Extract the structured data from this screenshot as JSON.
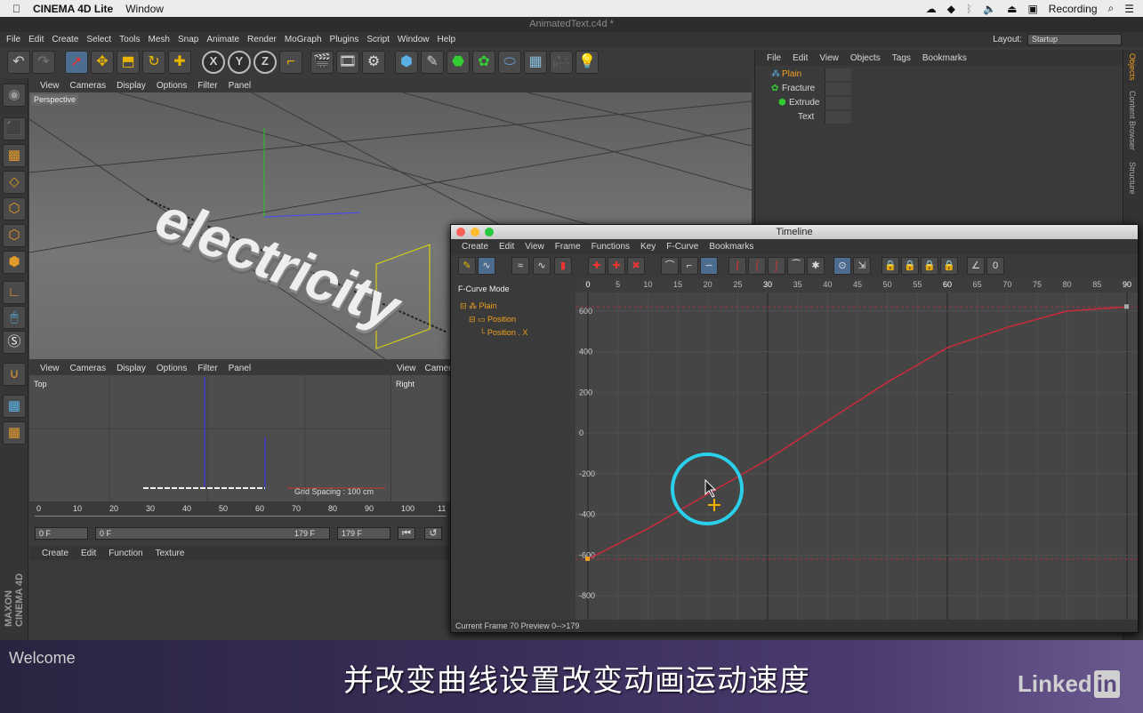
{
  "mac_menubar": {
    "app": "CINEMA 4D Lite",
    "menu": "Window",
    "recording": "Recording"
  },
  "document_title": "AnimatedText.c4d *",
  "main_menu": [
    "File",
    "Edit",
    "Create",
    "Select",
    "Tools",
    "Mesh",
    "Snap",
    "Animate",
    "Render",
    "MoGraph",
    "Plugins",
    "Script",
    "Window",
    "Help"
  ],
  "layout": {
    "label": "Layout:",
    "value": "Startup"
  },
  "viewport_menu": [
    "View",
    "Cameras",
    "Display",
    "Options",
    "Filter",
    "Panel"
  ],
  "viewport_perspective": {
    "label": "Perspective",
    "text3d": "electricity"
  },
  "viewport_top": {
    "label": "Top",
    "grid": "Grid Spacing : 100 cm"
  },
  "viewport_right": {
    "label": "Right",
    "menu": [
      "View",
      "Camer"
    ]
  },
  "timeline_ruler": {
    "ticks": [
      "0",
      "10",
      "20",
      "30",
      "40",
      "50",
      "60",
      "70",
      "80",
      "90",
      "100",
      "11"
    ]
  },
  "frame_fields": {
    "start": "0 F",
    "range_start": "0 F",
    "range_end": "179 F",
    "end": "179 F"
  },
  "material_menu": [
    "Create",
    "Edit",
    "Function",
    "Texture"
  ],
  "maxon_logo": "MAXON CINEMA 4D",
  "object_manager": {
    "menu": [
      "File",
      "Edit",
      "View",
      "Objects",
      "Tags",
      "Bookmarks"
    ],
    "objects": [
      "Plain",
      "Fracture",
      "Extrude",
      "Text"
    ]
  },
  "right_tabs": [
    "Objects",
    "Content Browser",
    "Structure"
  ],
  "timeline": {
    "title": "Timeline",
    "menu": [
      "Create",
      "Edit",
      "View",
      "Frame",
      "Functions",
      "Key",
      "F-Curve",
      "Bookmarks"
    ],
    "mode": "F-Curve Mode",
    "tracks": [
      "Plain",
      "Position",
      "Position . X"
    ],
    "frame_ticks": [
      "0",
      "5",
      "10",
      "15",
      "20",
      "25",
      "30",
      "35",
      "40",
      "45",
      "50",
      "55",
      "60",
      "65",
      "70",
      "75",
      "80",
      "85",
      "90"
    ],
    "value_ticks": [
      "600",
      "400",
      "200",
      "0",
      "-200",
      "-400",
      "-600",
      "-800"
    ],
    "status": {
      "current_frame_label": "Current Frame",
      "current_frame": "70",
      "preview_label": "Preview",
      "preview": "0-->179"
    }
  },
  "chart_data": {
    "type": "line",
    "title": "",
    "xlabel": "",
    "ylabel": "",
    "xlim": [
      0,
      90
    ],
    "ylim": [
      -900,
      700
    ],
    "series": [
      {
        "x": [
          0,
          10,
          20,
          30,
          40,
          50,
          60,
          70,
          80,
          90
        ],
        "y": [
          -620,
          -470,
          -300,
          -130,
          60,
          250,
          420,
          520,
          600,
          620
        ]
      }
    ],
    "accent_color": "#cc2a3a"
  },
  "banner": {
    "welcome": "Welcome",
    "subtitle": "并改变曲线设置改变动画运动速度",
    "brand": "Linked",
    "brand_in": "in"
  }
}
